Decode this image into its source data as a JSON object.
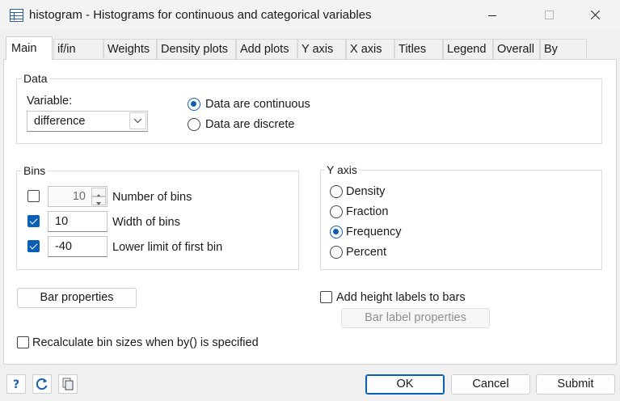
{
  "window": {
    "title": "histogram - Histograms for continuous and categorical variables"
  },
  "tabs": [
    {
      "label": "Main",
      "active": true
    },
    {
      "label": "if/in"
    },
    {
      "label": "Weights"
    },
    {
      "label": "Density plots"
    },
    {
      "label": "Add plots"
    },
    {
      "label": "Y axis"
    },
    {
      "label": "X axis"
    },
    {
      "label": "Titles"
    },
    {
      "label": "Legend"
    },
    {
      "label": "Overall"
    },
    {
      "label": "By"
    }
  ],
  "data_group": {
    "title": "Data",
    "variable_label": "Variable:",
    "variable_value": "difference",
    "options": [
      {
        "label": "Data are continuous",
        "selected": true
      },
      {
        "label": "Data are discrete",
        "selected": false
      }
    ]
  },
  "bins_group": {
    "title": "Bins",
    "rows": [
      {
        "checked": false,
        "value": "10",
        "label": "Number of bins"
      },
      {
        "checked": true,
        "value": "10",
        "label": "Width of bins"
      },
      {
        "checked": true,
        "value": "-40",
        "label": "Lower limit of first bin"
      }
    ]
  },
  "yaxis_group": {
    "title": "Y axis",
    "options": [
      {
        "label": "Density",
        "selected": false
      },
      {
        "label": "Fraction",
        "selected": false
      },
      {
        "label": "Frequency",
        "selected": true
      },
      {
        "label": "Percent",
        "selected": false
      }
    ]
  },
  "bar_properties_label": "Bar properties",
  "height_labels": {
    "label": "Add height labels to bars",
    "checked": false
  },
  "bar_label_properties_label": "Bar label properties",
  "recalculate": {
    "label": "Recalculate bin sizes when by() is specified",
    "checked": false
  },
  "footer": {
    "ok_label": "OK",
    "cancel_label": "Cancel",
    "submit_label": "Submit"
  },
  "colors": {
    "accent": "#0a5fb5"
  }
}
